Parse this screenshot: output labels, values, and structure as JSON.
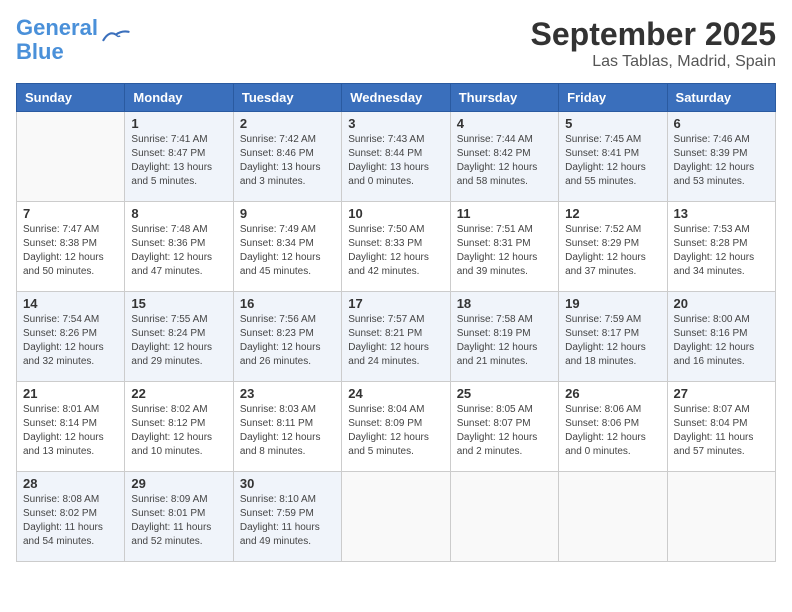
{
  "logo": {
    "line1": "General",
    "line2": "Blue"
  },
  "title": "September 2025",
  "subtitle": "Las Tablas, Madrid, Spain",
  "days_of_week": [
    "Sunday",
    "Monday",
    "Tuesday",
    "Wednesday",
    "Thursday",
    "Friday",
    "Saturday"
  ],
  "weeks": [
    [
      {
        "day": "",
        "sunrise": "",
        "sunset": "",
        "daylight": ""
      },
      {
        "day": "1",
        "sunrise": "Sunrise: 7:41 AM",
        "sunset": "Sunset: 8:47 PM",
        "daylight": "Daylight: 13 hours and 5 minutes."
      },
      {
        "day": "2",
        "sunrise": "Sunrise: 7:42 AM",
        "sunset": "Sunset: 8:46 PM",
        "daylight": "Daylight: 13 hours and 3 minutes."
      },
      {
        "day": "3",
        "sunrise": "Sunrise: 7:43 AM",
        "sunset": "Sunset: 8:44 PM",
        "daylight": "Daylight: 13 hours and 0 minutes."
      },
      {
        "day": "4",
        "sunrise": "Sunrise: 7:44 AM",
        "sunset": "Sunset: 8:42 PM",
        "daylight": "Daylight: 12 hours and 58 minutes."
      },
      {
        "day": "5",
        "sunrise": "Sunrise: 7:45 AM",
        "sunset": "Sunset: 8:41 PM",
        "daylight": "Daylight: 12 hours and 55 minutes."
      },
      {
        "day": "6",
        "sunrise": "Sunrise: 7:46 AM",
        "sunset": "Sunset: 8:39 PM",
        "daylight": "Daylight: 12 hours and 53 minutes."
      }
    ],
    [
      {
        "day": "7",
        "sunrise": "Sunrise: 7:47 AM",
        "sunset": "Sunset: 8:38 PM",
        "daylight": "Daylight: 12 hours and 50 minutes."
      },
      {
        "day": "8",
        "sunrise": "Sunrise: 7:48 AM",
        "sunset": "Sunset: 8:36 PM",
        "daylight": "Daylight: 12 hours and 47 minutes."
      },
      {
        "day": "9",
        "sunrise": "Sunrise: 7:49 AM",
        "sunset": "Sunset: 8:34 PM",
        "daylight": "Daylight: 12 hours and 45 minutes."
      },
      {
        "day": "10",
        "sunrise": "Sunrise: 7:50 AM",
        "sunset": "Sunset: 8:33 PM",
        "daylight": "Daylight: 12 hours and 42 minutes."
      },
      {
        "day": "11",
        "sunrise": "Sunrise: 7:51 AM",
        "sunset": "Sunset: 8:31 PM",
        "daylight": "Daylight: 12 hours and 39 minutes."
      },
      {
        "day": "12",
        "sunrise": "Sunrise: 7:52 AM",
        "sunset": "Sunset: 8:29 PM",
        "daylight": "Daylight: 12 hours and 37 minutes."
      },
      {
        "day": "13",
        "sunrise": "Sunrise: 7:53 AM",
        "sunset": "Sunset: 8:28 PM",
        "daylight": "Daylight: 12 hours and 34 minutes."
      }
    ],
    [
      {
        "day": "14",
        "sunrise": "Sunrise: 7:54 AM",
        "sunset": "Sunset: 8:26 PM",
        "daylight": "Daylight: 12 hours and 32 minutes."
      },
      {
        "day": "15",
        "sunrise": "Sunrise: 7:55 AM",
        "sunset": "Sunset: 8:24 PM",
        "daylight": "Daylight: 12 hours and 29 minutes."
      },
      {
        "day": "16",
        "sunrise": "Sunrise: 7:56 AM",
        "sunset": "Sunset: 8:23 PM",
        "daylight": "Daylight: 12 hours and 26 minutes."
      },
      {
        "day": "17",
        "sunrise": "Sunrise: 7:57 AM",
        "sunset": "Sunset: 8:21 PM",
        "daylight": "Daylight: 12 hours and 24 minutes."
      },
      {
        "day": "18",
        "sunrise": "Sunrise: 7:58 AM",
        "sunset": "Sunset: 8:19 PM",
        "daylight": "Daylight: 12 hours and 21 minutes."
      },
      {
        "day": "19",
        "sunrise": "Sunrise: 7:59 AM",
        "sunset": "Sunset: 8:17 PM",
        "daylight": "Daylight: 12 hours and 18 minutes."
      },
      {
        "day": "20",
        "sunrise": "Sunrise: 8:00 AM",
        "sunset": "Sunset: 8:16 PM",
        "daylight": "Daylight: 12 hours and 16 minutes."
      }
    ],
    [
      {
        "day": "21",
        "sunrise": "Sunrise: 8:01 AM",
        "sunset": "Sunset: 8:14 PM",
        "daylight": "Daylight: 12 hours and 13 minutes."
      },
      {
        "day": "22",
        "sunrise": "Sunrise: 8:02 AM",
        "sunset": "Sunset: 8:12 PM",
        "daylight": "Daylight: 12 hours and 10 minutes."
      },
      {
        "day": "23",
        "sunrise": "Sunrise: 8:03 AM",
        "sunset": "Sunset: 8:11 PM",
        "daylight": "Daylight: 12 hours and 8 minutes."
      },
      {
        "day": "24",
        "sunrise": "Sunrise: 8:04 AM",
        "sunset": "Sunset: 8:09 PM",
        "daylight": "Daylight: 12 hours and 5 minutes."
      },
      {
        "day": "25",
        "sunrise": "Sunrise: 8:05 AM",
        "sunset": "Sunset: 8:07 PM",
        "daylight": "Daylight: 12 hours and 2 minutes."
      },
      {
        "day": "26",
        "sunrise": "Sunrise: 8:06 AM",
        "sunset": "Sunset: 8:06 PM",
        "daylight": "Daylight: 12 hours and 0 minutes."
      },
      {
        "day": "27",
        "sunrise": "Sunrise: 8:07 AM",
        "sunset": "Sunset: 8:04 PM",
        "daylight": "Daylight: 11 hours and 57 minutes."
      }
    ],
    [
      {
        "day": "28",
        "sunrise": "Sunrise: 8:08 AM",
        "sunset": "Sunset: 8:02 PM",
        "daylight": "Daylight: 11 hours and 54 minutes."
      },
      {
        "day": "29",
        "sunrise": "Sunrise: 8:09 AM",
        "sunset": "Sunset: 8:01 PM",
        "daylight": "Daylight: 11 hours and 52 minutes."
      },
      {
        "day": "30",
        "sunrise": "Sunrise: 8:10 AM",
        "sunset": "Sunset: 7:59 PM",
        "daylight": "Daylight: 11 hours and 49 minutes."
      },
      {
        "day": "",
        "sunrise": "",
        "sunset": "",
        "daylight": ""
      },
      {
        "day": "",
        "sunrise": "",
        "sunset": "",
        "daylight": ""
      },
      {
        "day": "",
        "sunrise": "",
        "sunset": "",
        "daylight": ""
      },
      {
        "day": "",
        "sunrise": "",
        "sunset": "",
        "daylight": ""
      }
    ]
  ]
}
